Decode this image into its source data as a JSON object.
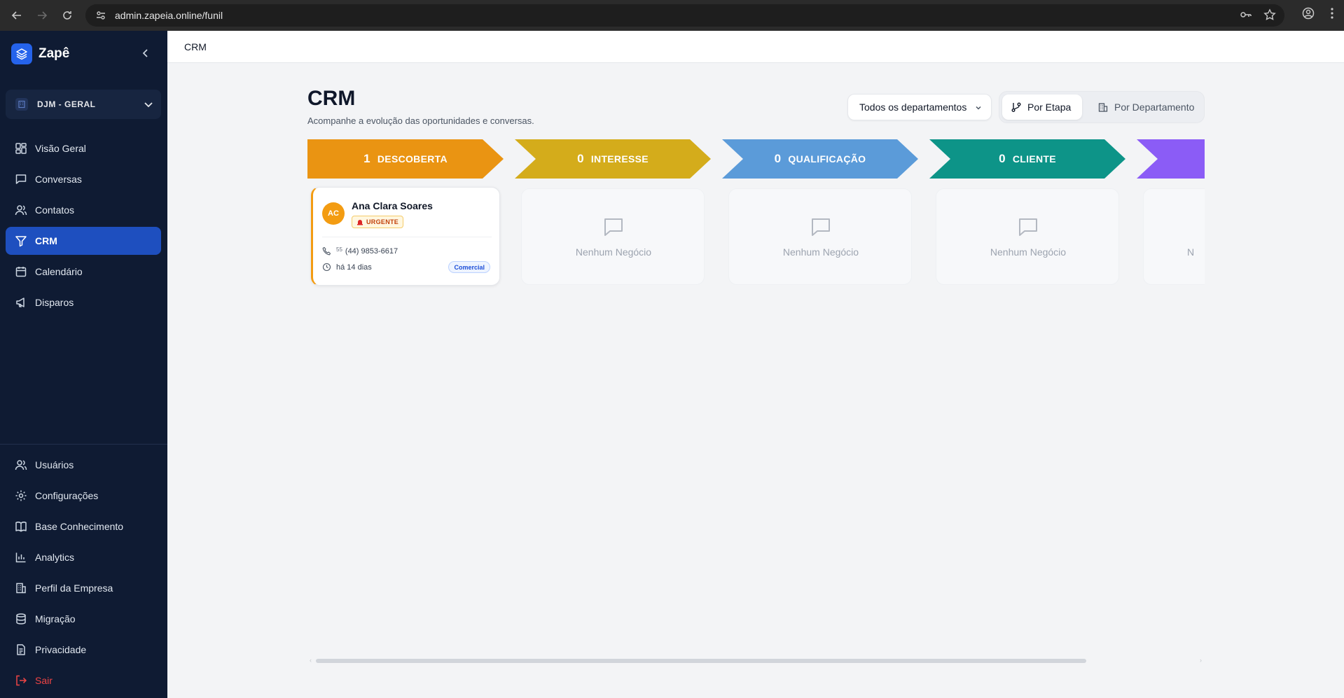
{
  "browser": {
    "url": "admin.zapeia.online/funil"
  },
  "sidebar": {
    "brand": "Zapê",
    "workspace": "DJM - GERAL",
    "nav": [
      {
        "label": "Visão Geral",
        "icon": "dashboard-icon"
      },
      {
        "label": "Conversas",
        "icon": "chat-icon"
      },
      {
        "label": "Contatos",
        "icon": "users-icon"
      },
      {
        "label": "CRM",
        "icon": "funnel-icon",
        "active": true
      },
      {
        "label": "Calendário",
        "icon": "calendar-icon"
      },
      {
        "label": "Disparos",
        "icon": "megaphone-icon"
      }
    ],
    "bottom_nav": [
      {
        "label": "Usuários",
        "icon": "users-icon"
      },
      {
        "label": "Configurações",
        "icon": "gear-icon"
      },
      {
        "label": "Base Conhecimento",
        "icon": "book-icon"
      },
      {
        "label": "Analytics",
        "icon": "bar-chart-icon"
      },
      {
        "label": "Perfil da Empresa",
        "icon": "building-icon"
      },
      {
        "label": "Migração",
        "icon": "database-icon"
      },
      {
        "label": "Privacidade",
        "icon": "document-icon"
      },
      {
        "label": "Sair",
        "icon": "logout-icon"
      }
    ]
  },
  "header": {
    "breadcrumb": "CRM"
  },
  "page": {
    "title": "CRM",
    "subtitle": "Acompanhe a evolução das oportunidades e conversas.",
    "department_filter": "Todos os departamentos",
    "view_toggle": {
      "by_stage": "Por Etapa",
      "by_department": "Por Departamento"
    }
  },
  "stages": [
    {
      "count": "1",
      "name": "DESCOBERTA",
      "color": "#ea9412"
    },
    {
      "count": "0",
      "name": "INTERESSE",
      "color": "#d4ac1b"
    },
    {
      "count": "0",
      "name": "QUALIFICAÇÃO",
      "color": "#5b9bd9"
    },
    {
      "count": "0",
      "name": "CLIENTE",
      "color": "#0d9488"
    },
    {
      "count": "",
      "name": "",
      "color": "#8b5cf6"
    }
  ],
  "empty_text": "Nenhum Negócio",
  "empty_text_partial": "N",
  "deal": {
    "initials": "AC",
    "name": "Ana Clara Soares",
    "priority": "URGENTE",
    "country_code": "55",
    "phone": "(44) 9853-6617",
    "time": "há 14 dias",
    "department": "Comercial",
    "accent": "#f39c12"
  }
}
